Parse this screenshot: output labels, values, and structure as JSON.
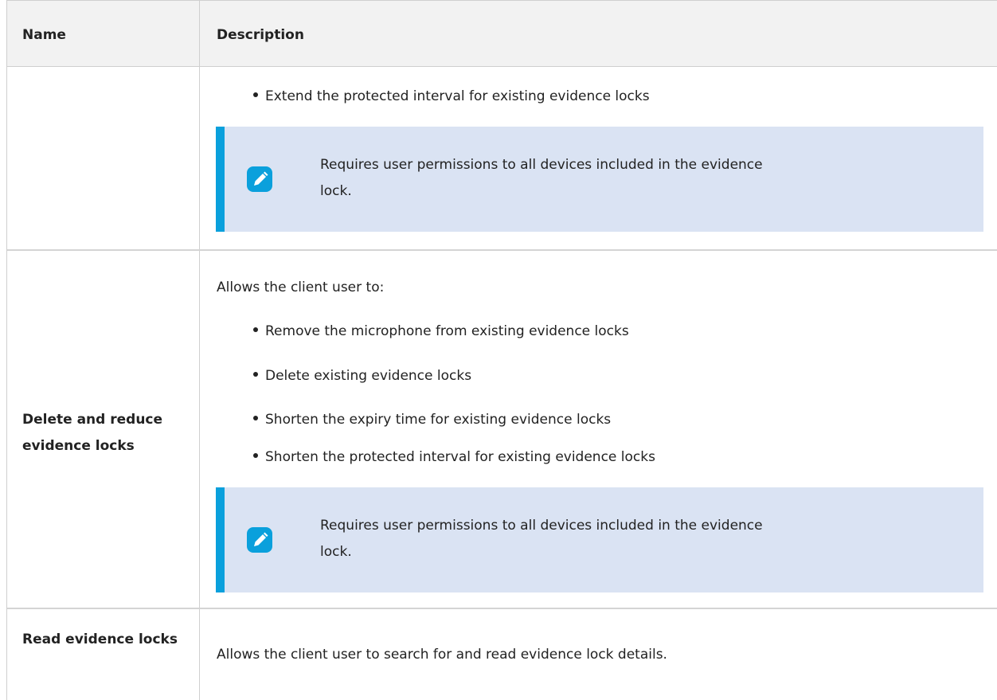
{
  "table": {
    "headers": {
      "name": "Name",
      "description": "Description"
    },
    "rows": [
      {
        "name": "",
        "bullets": [
          "Extend the protected interval for existing evidence locks"
        ],
        "note": "Requires user permissions to all devices included in the evidence lock."
      },
      {
        "name": "Delete and reduce evidence locks",
        "intro": "Allows the client user to:",
        "bullets": [
          "Remove the microphone from existing evidence locks",
          "Delete existing evidence locks",
          "Shorten the expiry time for existing evidence locks",
          "Shorten the protected interval for existing evidence locks"
        ],
        "note": "Requires user permissions to all devices included in the evidence lock."
      },
      {
        "name": "Read evidence locks",
        "description": "Allows the client user to search for and read evidence lock details."
      }
    ]
  },
  "colors": {
    "note_background": "#dae3f3",
    "note_accent": "#0aa0dc",
    "header_background": "#f2f2f2"
  },
  "icons": {
    "note": "pencil-note-icon"
  }
}
